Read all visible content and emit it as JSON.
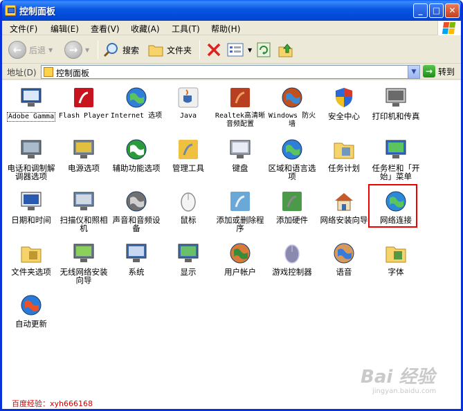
{
  "window": {
    "title": "控制面板"
  },
  "title_buttons": {
    "minimize": "_",
    "maximize": "□",
    "close": "✕"
  },
  "menu": [
    "文件(F)",
    "编辑(E)",
    "查看(V)",
    "收藏(A)",
    "工具(T)",
    "帮助(H)"
  ],
  "toolbar": {
    "back": "后退",
    "search": "搜索",
    "folders": "文件夹"
  },
  "address": {
    "label": "地址(D)",
    "value": "控制面板",
    "go": "转到"
  },
  "items": [
    {
      "label": "Adobe Gamma",
      "icon": "monitor-icon"
    },
    {
      "label": "Flash Player",
      "icon": "flash-icon"
    },
    {
      "label": "Internet 选项",
      "icon": "globe-icon"
    },
    {
      "label": "Java",
      "icon": "java-icon"
    },
    {
      "label": "Realtek高清晰音频配置",
      "icon": "speaker-icon"
    },
    {
      "label": "Windows 防火墙",
      "icon": "firewall-icon"
    },
    {
      "label": "安全中心",
      "icon": "shield-icon"
    },
    {
      "label": "打印机和传真",
      "icon": "printer-icon"
    },
    {
      "label": "电话和调制解调器选项",
      "icon": "phone-icon"
    },
    {
      "label": "电源选项",
      "icon": "power-icon"
    },
    {
      "label": "辅助功能选项",
      "icon": "accessibility-icon"
    },
    {
      "label": "管理工具",
      "icon": "tools-icon"
    },
    {
      "label": "键盘",
      "icon": "keyboard-icon"
    },
    {
      "label": "区域和语言选项",
      "icon": "globe-icon"
    },
    {
      "label": "任务计划",
      "icon": "folder-clock-icon"
    },
    {
      "label": "任务栏和「开始」菜单",
      "icon": "taskbar-icon"
    },
    {
      "label": "日期和时间",
      "icon": "calendar-icon"
    },
    {
      "label": "扫描仪和照相机",
      "icon": "scanner-icon"
    },
    {
      "label": "声音和音频设备",
      "icon": "sound-icon"
    },
    {
      "label": "鼠标",
      "icon": "mouse-icon"
    },
    {
      "label": "添加或删除程序",
      "icon": "cd-box-icon"
    },
    {
      "label": "添加硬件",
      "icon": "hardware-icon"
    },
    {
      "label": "网络安装向导",
      "icon": "house-icon"
    },
    {
      "label": "网络连接",
      "icon": "network-globe-icon"
    },
    {
      "label": "文件夹选项",
      "icon": "folder-icon"
    },
    {
      "label": "无线网络安装向导",
      "icon": "wireless-icon"
    },
    {
      "label": "系统",
      "icon": "computer-icon"
    },
    {
      "label": "显示",
      "icon": "display-icon"
    },
    {
      "label": "用户帐户",
      "icon": "users-icon"
    },
    {
      "label": "游戏控制器",
      "icon": "gamepad-icon"
    },
    {
      "label": "语音",
      "icon": "speech-icon"
    },
    {
      "label": "字体",
      "icon": "fonts-folder-icon"
    },
    {
      "label": "自动更新",
      "icon": "windows-update-icon"
    }
  ],
  "footer_note": "百度经验：xyh666168",
  "watermark": {
    "main": "Bai 经验",
    "sub": "jingyan.baidu.com"
  },
  "colors": {
    "title_bar": "#0856e0",
    "highlight_border": "#e00000",
    "note_text": "#d40000"
  }
}
